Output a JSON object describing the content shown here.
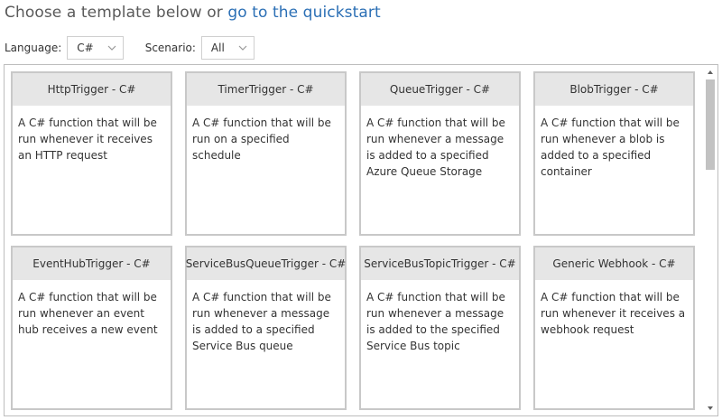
{
  "header": {
    "prefix": "Choose a template below or ",
    "link": "go to the quickstart"
  },
  "filters": {
    "language_label": "Language:",
    "language_value": "C#",
    "scenario_label": "Scenario:",
    "scenario_value": "All"
  },
  "templates": [
    {
      "title": "HttpTrigger - C#",
      "desc": "A C# function that will be run whenever it receives an HTTP request"
    },
    {
      "title": "TimerTrigger - C#",
      "desc": "A C# function that will be run on a specified schedule"
    },
    {
      "title": "QueueTrigger - C#",
      "desc": "A C# function that will be run whenever a message is added to a specified Azure Queue Storage"
    },
    {
      "title": "BlobTrigger - C#",
      "desc": "A C# function that will be run whenever a blob is added to a specified container"
    },
    {
      "title": "EventHubTrigger - C#",
      "desc": "A C# function that will be run whenever an event hub receives a new event"
    },
    {
      "title": "ServiceBusQueueTrigger - C#",
      "desc": "A C# function that will be run whenever a message is added to a specified Service Bus queue"
    },
    {
      "title": "ServiceBusTopicTrigger - C#",
      "desc": "A C# function that will be run whenever a message is added to the specified Service Bus topic"
    },
    {
      "title": "Generic Webhook - C#",
      "desc": "A C# function that will be run whenever it receives a webhook request"
    }
  ],
  "icons": {
    "chevron": "chevron-down-icon",
    "scroll_up": "scroll-up-arrow-icon",
    "scroll_down": "scroll-down-arrow-icon"
  }
}
